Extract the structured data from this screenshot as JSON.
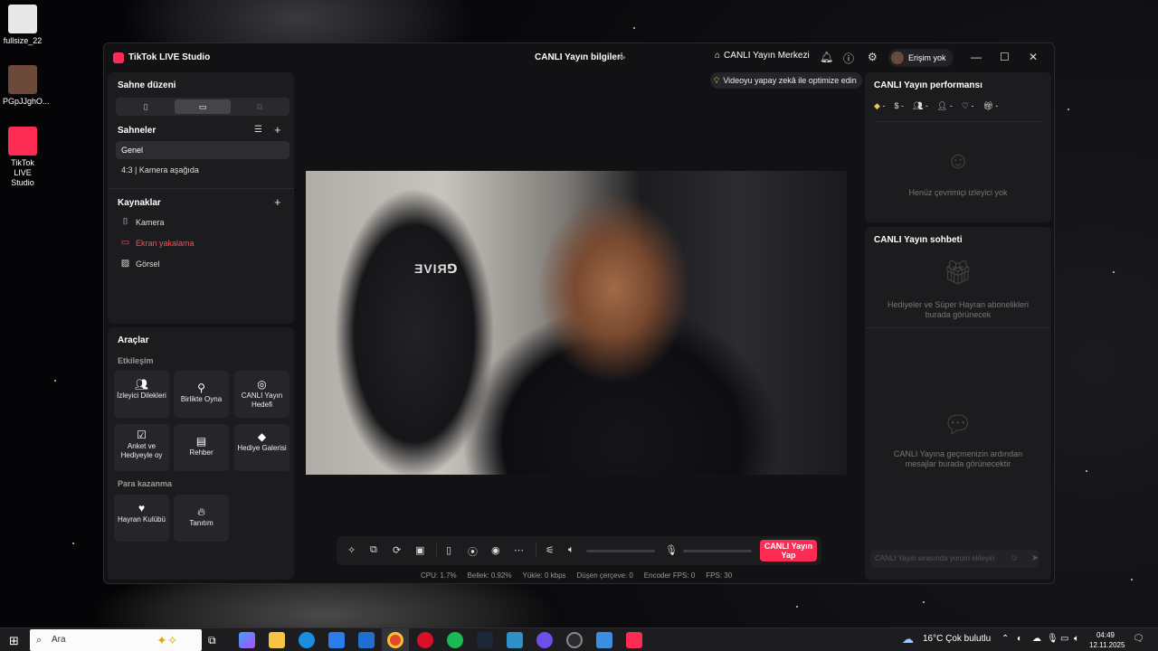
{
  "desktop": {
    "icons": [
      {
        "label": "fullsize_22"
      },
      {
        "label": "PGpJJghO..."
      },
      {
        "label": "TikTok LIVE Studio"
      }
    ]
  },
  "window": {
    "app_name": "TikTok LIVE Studio",
    "center_title": "CANLI Yayın bilgileri",
    "hub_label": "CANLI Yayın Merkezi",
    "account_label": "Erişim yok"
  },
  "left": {
    "layout_title": "Sahne düzeni",
    "scenes_title": "Sahneler",
    "scenes": [
      "Genel",
      "4:3 | Kamera aşağıda"
    ],
    "sources_title": "Kaynaklar",
    "sources": [
      {
        "label": "Kamera",
        "icon": "camera-icon"
      },
      {
        "label": "Ekran yakalama",
        "icon": "monitor-icon",
        "color": "#ff4b5c"
      },
      {
        "label": "Görsel",
        "icon": "image-icon"
      }
    ],
    "tools_title": "Araçlar",
    "engagement_label": "Etkileşim",
    "tools": [
      "İzleyici Dilekleri",
      "Birlikte Oyna",
      "CANLI Yayın Hedefi",
      "Anket ve Hediyeyle oy",
      "Rehber",
      "Hediye Galerisi"
    ],
    "monetize_label": "Para kazanma",
    "monetize_tools": [
      "Hayran Kulübü",
      "Tanıtım"
    ]
  },
  "center": {
    "ai_chip": "Videoyu yapay zekâ ile optimize edin",
    "go_live": "CANLI Yayın Yap",
    "stats": {
      "cpu": "CPU:  1.7%",
      "memory": "Bellek:  0.92%",
      "upload": "Yükle:  0 kbps",
      "dropped": "Düşen çerçeve:  0",
      "encoder_fps": "Encoder FPS:  0",
      "fps": "FPS:  30"
    }
  },
  "right": {
    "perf_title": "CANLI Yayın performansı",
    "perf_metrics": [
      "-",
      "-",
      "-",
      "-",
      "-",
      "-"
    ],
    "no_viewers": "Henüz çevrimiçi izleyici yok",
    "chat_title": "CANLI Yayın sohbeti",
    "gifts_note": "Hediyeler ve Süper Hayran abonelikleri burada görünecek",
    "messages_note": "CANLI Yayına geçmenizin ardından mesajlar burada görünecektir",
    "chat_placeholder": "CANLI Yayın sırasında yorum ekleyin"
  },
  "taskbar": {
    "search": "Ara",
    "weather": "16°C  Çok bulutlu",
    "time": "04:49",
    "date": "12.11.2025"
  },
  "colors": {
    "accent": "#fe2c55",
    "panel": "#1c1c1f",
    "window_bg": "#121214"
  }
}
